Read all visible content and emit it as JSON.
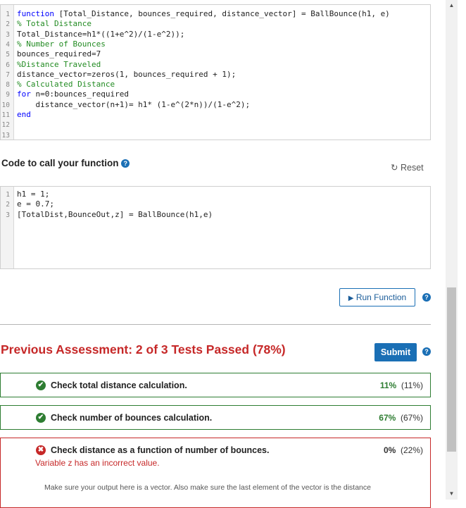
{
  "function_editor": {
    "lines": [
      {
        "num": "1",
        "segments": [
          {
            "t": "function",
            "c": "kw"
          },
          {
            "t": " [Total_Distance, bounces_required, distance_vector] = BallBounce(h1, e)",
            "c": ""
          }
        ]
      },
      {
        "num": "2",
        "segments": [
          {
            "t": "% Total Distance",
            "c": "cm"
          }
        ]
      },
      {
        "num": "3",
        "segments": [
          {
            "t": "Total_Distance=h1*((1+e^2)/(1-e^2));",
            "c": ""
          }
        ]
      },
      {
        "num": "4",
        "segments": [
          {
            "t": "% Number of Bounces",
            "c": "cm"
          }
        ]
      },
      {
        "num": "5",
        "segments": [
          {
            "t": "bounces_required=7",
            "c": ""
          }
        ]
      },
      {
        "num": "6",
        "segments": [
          {
            "t": "%Distance Traveled",
            "c": "cm"
          }
        ]
      },
      {
        "num": "7",
        "segments": [
          {
            "t": "distance_vector=zeros(1, bounces_required + 1);",
            "c": ""
          }
        ]
      },
      {
        "num": "8",
        "segments": [
          {
            "t": "% Calculated Distance",
            "c": "cm"
          }
        ]
      },
      {
        "num": "9",
        "segments": [
          {
            "t": "for",
            "c": "kw"
          },
          {
            "t": " n=0:bounces_required",
            "c": ""
          }
        ]
      },
      {
        "num": "10",
        "segments": [
          {
            "t": "    distance_vector(n+1)= h1* (1-e^(2*n))/(1-e^2);",
            "c": ""
          }
        ]
      },
      {
        "num": "11",
        "segments": [
          {
            "t": "end",
            "c": "kw"
          }
        ]
      },
      {
        "num": "12",
        "segments": []
      },
      {
        "num": "13",
        "segments": []
      }
    ]
  },
  "call_section": {
    "title": "Code to call your function",
    "help_glyph": "?",
    "reset_icon": "↻",
    "reset_label": "Reset",
    "lines": [
      {
        "num": "1",
        "segments": [
          {
            "t": "h1 = 1;",
            "c": ""
          }
        ]
      },
      {
        "num": "2",
        "segments": [
          {
            "t": "e = 0.7;",
            "c": ""
          }
        ]
      },
      {
        "num": "3",
        "segments": [
          {
            "t": "[TotalDist,BounceOut,z] = BallBounce(h1,e)",
            "c": ""
          }
        ]
      }
    ]
  },
  "run_button": {
    "icon": "▶",
    "label": "Run Function"
  },
  "assessment": {
    "title": "Previous Assessment: 2 of 3 Tests Passed (78%)",
    "submit_label": "Submit",
    "tests": [
      {
        "status": "pass",
        "icon": "✔",
        "name": "Check total distance calculation.",
        "score": "11%",
        "weight": "(11%)"
      },
      {
        "status": "pass",
        "icon": "✔",
        "name": "Check number of bounces calculation.",
        "score": "67%",
        "weight": "(67%)"
      },
      {
        "status": "fail",
        "icon": "✖",
        "name": "Check distance as a function of number of bounces.",
        "score": "0%",
        "weight": "(22%)",
        "error": "Variable z has an incorrect value.",
        "note": "Make sure your output here is a vector. Also make sure the last element of the vector is the distance"
      }
    ]
  },
  "colors": {
    "accent": "#1a6fb5",
    "pass": "#2e7d32",
    "fail": "#c62828"
  },
  "scrollbar": {
    "up_arrow": "▲",
    "down_arrow": "▼"
  }
}
